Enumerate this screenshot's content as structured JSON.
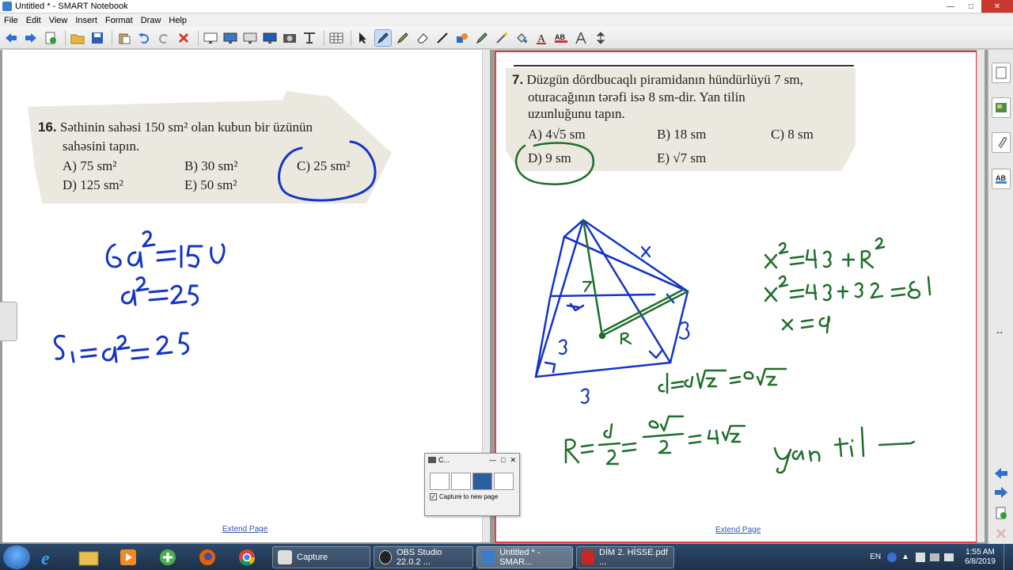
{
  "window": {
    "title": "Untitled * - SMART Notebook"
  },
  "menu": [
    "File",
    "Edit",
    "View",
    "Insert",
    "Format",
    "Draw",
    "Help"
  ],
  "left_page": {
    "question_number": "16.",
    "question_line1": "Səthinin sahəsi 150 sm² olan kubun bir üzünün",
    "question_line2": "sahəsini tapın.",
    "opt_a": "A) 75 sm²",
    "opt_b": "B) 30 sm²",
    "opt_c": "C) 25 sm²",
    "opt_d": "D) 125 sm²",
    "opt_e": "E) 50 sm²",
    "extend_link": "Extend Page"
  },
  "right_page": {
    "question_number": "7.",
    "question_line1": "Düzgün dördbucaqlı piramidanın hündürlüyü 7 sm,",
    "question_line2": "oturacağının tərəfi isə 8 sm-dir. Yan tilin",
    "question_line3": "uzunluğunu tapın.",
    "opt_a": "A) 4√5 sm",
    "opt_b": "B) 18 sm",
    "opt_c": "C) 8 sm",
    "opt_d": "D) 9 sm",
    "opt_e": "E) √7 sm",
    "extend_link": "Extend Page"
  },
  "capture_dialog": {
    "title": "C...",
    "checkbox_label": "Capture to new page",
    "checked": true
  },
  "taskbar": {
    "tasks": [
      {
        "label": "Capture"
      },
      {
        "label": "OBS Studio 22.0.2 ..."
      },
      {
        "label": "Untitled * - SMAR..."
      },
      {
        "label": "DİM 2. HİSSE.pdf ..."
      }
    ],
    "language": "EN",
    "time": "1:55 AM",
    "date": "6/8/2019"
  },
  "colors": {
    "ink_blue": "#1434c8",
    "ink_green": "#1e6e2a",
    "page_border_active": "#dd4444"
  }
}
